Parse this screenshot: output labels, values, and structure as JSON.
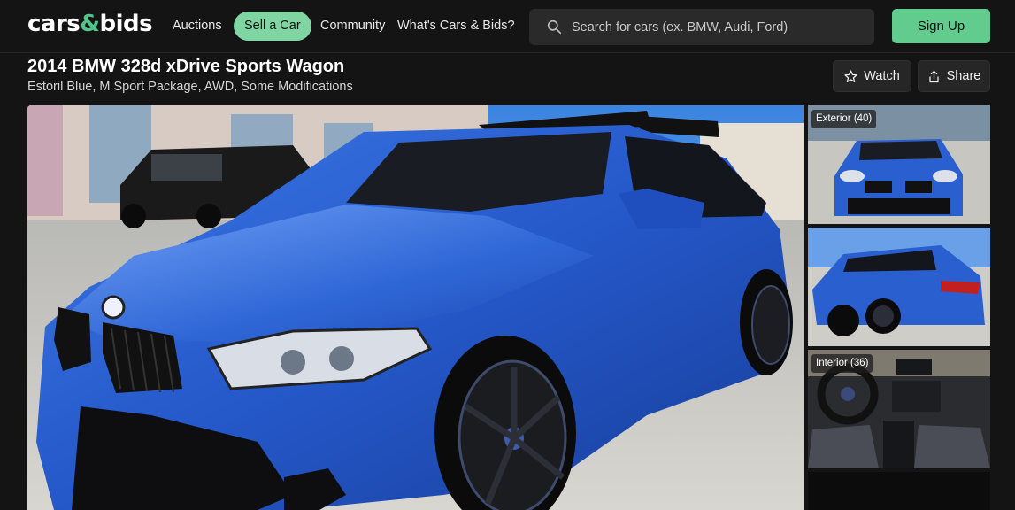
{
  "header": {
    "logo": {
      "left": "cars",
      "amp": "&",
      "right": "bids"
    },
    "nav": [
      {
        "label": "Auctions"
      },
      {
        "label": "Sell a Car"
      },
      {
        "label": "Community"
      },
      {
        "label": "What's Cars & Bids?"
      }
    ],
    "search": {
      "placeholder": "Search for cars (ex. BMW, Audi, Ford)"
    },
    "signup_label": "Sign Up"
  },
  "listing": {
    "title": "2014 BMW 328d xDrive Sports Wagon",
    "subtitle": "Estoril Blue, M Sport Package, AWD, Some Modifications",
    "watch_label": "Watch",
    "share_label": "Share"
  },
  "gallery": {
    "exterior_label": "Exterior (40)",
    "interior_label": "Interior (36)"
  },
  "colors": {
    "accent": "#52c68a",
    "background": "#141414",
    "car_blue": "#2a5fd0"
  }
}
